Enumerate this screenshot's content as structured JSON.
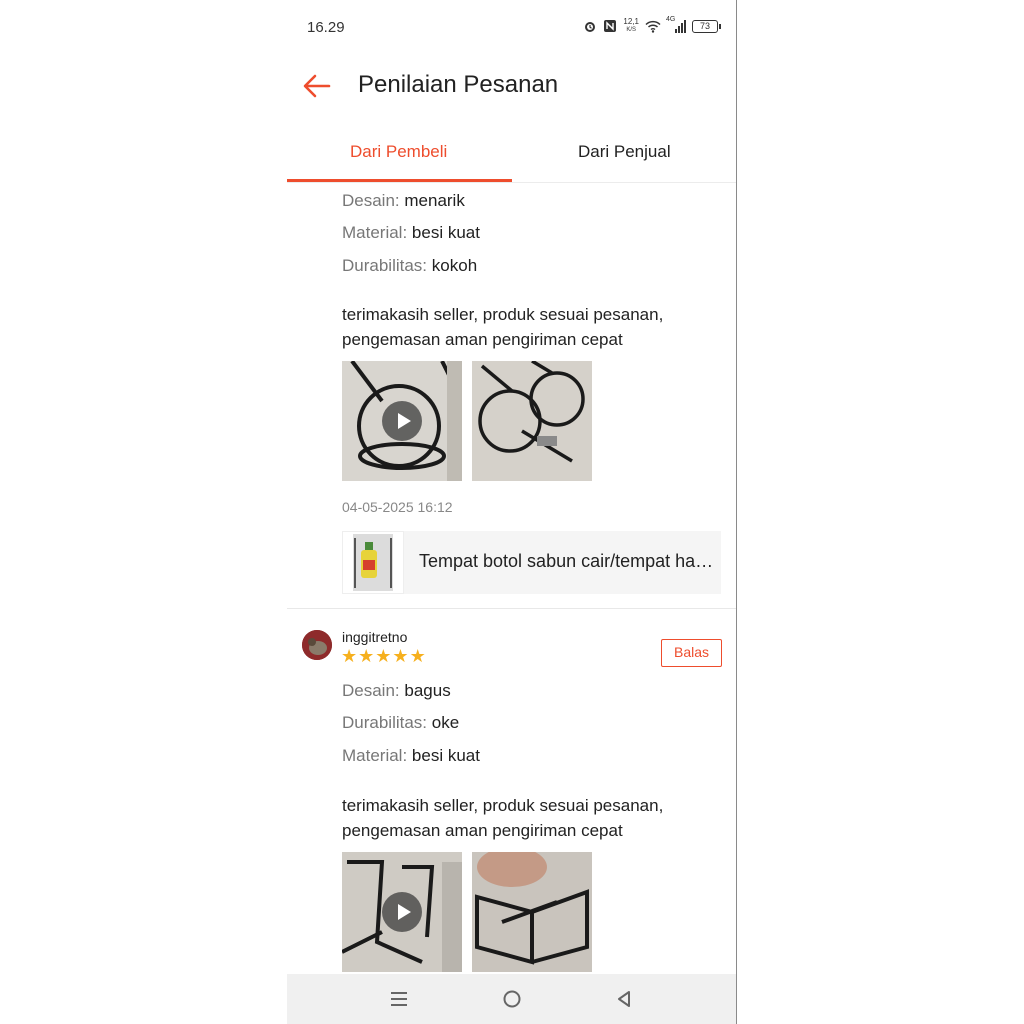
{
  "status_bar": {
    "time": "16.29",
    "network_speed_value": "12,1",
    "network_speed_unit": "K/S",
    "network_type": "4G",
    "battery": "73",
    "icons": [
      "alarm-icon",
      "nfc-icon",
      "wifi-icon",
      "signal-icon",
      "battery-icon"
    ]
  },
  "header": {
    "title": "Penilaian Pesanan",
    "back_icon": "arrow-left-icon",
    "accent_color": "#ee4d2d"
  },
  "tabs": [
    {
      "label": "Dari Pembeli",
      "active": true
    },
    {
      "label": "Dari Penjual",
      "active": false
    }
  ],
  "reviews": [
    {
      "attributes": [
        {
          "key": "Desain:",
          "value": "menarik"
        },
        {
          "key": "Material:",
          "value": "besi kuat"
        },
        {
          "key": "Durabilitas:",
          "value": "kokoh"
        }
      ],
      "comment_line1": "terimakasih seller, produk sesuai pesanan,",
      "comment_line2": "pengemasan aman pengiriman cepat",
      "date": "04-05-2025 16:12",
      "product_name": "Tempat botol sabun cair/tempat handsoap"
    },
    {
      "username": "inggitretno",
      "rating": 5,
      "reply_label": "Balas",
      "attributes": [
        {
          "key": "Desain:",
          "value": "bagus"
        },
        {
          "key": "Durabilitas:",
          "value": "oke"
        },
        {
          "key": "Material:",
          "value": "besi kuat"
        }
      ],
      "comment_line1": "terimakasih seller, produk sesuai pesanan,",
      "comment_line2": "pengemasan aman pengiriman cepat"
    }
  ],
  "nav": {
    "icons": [
      "menu-icon",
      "home-icon",
      "back-triangle-icon"
    ]
  }
}
